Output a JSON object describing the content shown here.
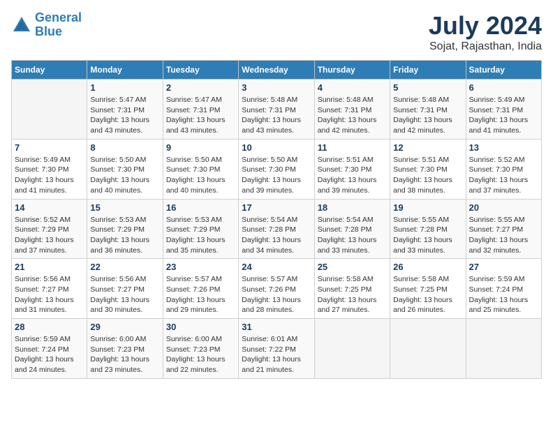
{
  "logo": {
    "line1": "General",
    "line2": "Blue"
  },
  "title": "July 2024",
  "subtitle": "Sojat, Rajasthan, India",
  "days_of_week": [
    "Sunday",
    "Monday",
    "Tuesday",
    "Wednesday",
    "Thursday",
    "Friday",
    "Saturday"
  ],
  "weeks": [
    [
      {
        "day": "",
        "info": ""
      },
      {
        "day": "1",
        "info": "Sunrise: 5:47 AM\nSunset: 7:31 PM\nDaylight: 13 hours and 43 minutes."
      },
      {
        "day": "2",
        "info": "Sunrise: 5:47 AM\nSunset: 7:31 PM\nDaylight: 13 hours and 43 minutes."
      },
      {
        "day": "3",
        "info": "Sunrise: 5:48 AM\nSunset: 7:31 PM\nDaylight: 13 hours and 43 minutes."
      },
      {
        "day": "4",
        "info": "Sunrise: 5:48 AM\nSunset: 7:31 PM\nDaylight: 13 hours and 42 minutes."
      },
      {
        "day": "5",
        "info": "Sunrise: 5:48 AM\nSunset: 7:31 PM\nDaylight: 13 hours and 42 minutes."
      },
      {
        "day": "6",
        "info": "Sunrise: 5:49 AM\nSunset: 7:31 PM\nDaylight: 13 hours and 41 minutes."
      }
    ],
    [
      {
        "day": "7",
        "info": "Sunrise: 5:49 AM\nSunset: 7:30 PM\nDaylight: 13 hours and 41 minutes."
      },
      {
        "day": "8",
        "info": "Sunrise: 5:50 AM\nSunset: 7:30 PM\nDaylight: 13 hours and 40 minutes."
      },
      {
        "day": "9",
        "info": "Sunrise: 5:50 AM\nSunset: 7:30 PM\nDaylight: 13 hours and 40 minutes."
      },
      {
        "day": "10",
        "info": "Sunrise: 5:50 AM\nSunset: 7:30 PM\nDaylight: 13 hours and 39 minutes."
      },
      {
        "day": "11",
        "info": "Sunrise: 5:51 AM\nSunset: 7:30 PM\nDaylight: 13 hours and 39 minutes."
      },
      {
        "day": "12",
        "info": "Sunrise: 5:51 AM\nSunset: 7:30 PM\nDaylight: 13 hours and 38 minutes."
      },
      {
        "day": "13",
        "info": "Sunrise: 5:52 AM\nSunset: 7:30 PM\nDaylight: 13 hours and 37 minutes."
      }
    ],
    [
      {
        "day": "14",
        "info": "Sunrise: 5:52 AM\nSunset: 7:29 PM\nDaylight: 13 hours and 37 minutes."
      },
      {
        "day": "15",
        "info": "Sunrise: 5:53 AM\nSunset: 7:29 PM\nDaylight: 13 hours and 36 minutes."
      },
      {
        "day": "16",
        "info": "Sunrise: 5:53 AM\nSunset: 7:29 PM\nDaylight: 13 hours and 35 minutes."
      },
      {
        "day": "17",
        "info": "Sunrise: 5:54 AM\nSunset: 7:28 PM\nDaylight: 13 hours and 34 minutes."
      },
      {
        "day": "18",
        "info": "Sunrise: 5:54 AM\nSunset: 7:28 PM\nDaylight: 13 hours and 33 minutes."
      },
      {
        "day": "19",
        "info": "Sunrise: 5:55 AM\nSunset: 7:28 PM\nDaylight: 13 hours and 33 minutes."
      },
      {
        "day": "20",
        "info": "Sunrise: 5:55 AM\nSunset: 7:27 PM\nDaylight: 13 hours and 32 minutes."
      }
    ],
    [
      {
        "day": "21",
        "info": "Sunrise: 5:56 AM\nSunset: 7:27 PM\nDaylight: 13 hours and 31 minutes."
      },
      {
        "day": "22",
        "info": "Sunrise: 5:56 AM\nSunset: 7:27 PM\nDaylight: 13 hours and 30 minutes."
      },
      {
        "day": "23",
        "info": "Sunrise: 5:57 AM\nSunset: 7:26 PM\nDaylight: 13 hours and 29 minutes."
      },
      {
        "day": "24",
        "info": "Sunrise: 5:57 AM\nSunset: 7:26 PM\nDaylight: 13 hours and 28 minutes."
      },
      {
        "day": "25",
        "info": "Sunrise: 5:58 AM\nSunset: 7:25 PM\nDaylight: 13 hours and 27 minutes."
      },
      {
        "day": "26",
        "info": "Sunrise: 5:58 AM\nSunset: 7:25 PM\nDaylight: 13 hours and 26 minutes."
      },
      {
        "day": "27",
        "info": "Sunrise: 5:59 AM\nSunset: 7:24 PM\nDaylight: 13 hours and 25 minutes."
      }
    ],
    [
      {
        "day": "28",
        "info": "Sunrise: 5:59 AM\nSunset: 7:24 PM\nDaylight: 13 hours and 24 minutes."
      },
      {
        "day": "29",
        "info": "Sunrise: 6:00 AM\nSunset: 7:23 PM\nDaylight: 13 hours and 23 minutes."
      },
      {
        "day": "30",
        "info": "Sunrise: 6:00 AM\nSunset: 7:23 PM\nDaylight: 13 hours and 22 minutes."
      },
      {
        "day": "31",
        "info": "Sunrise: 6:01 AM\nSunset: 7:22 PM\nDaylight: 13 hours and 21 minutes."
      },
      {
        "day": "",
        "info": ""
      },
      {
        "day": "",
        "info": ""
      },
      {
        "day": "",
        "info": ""
      }
    ]
  ]
}
